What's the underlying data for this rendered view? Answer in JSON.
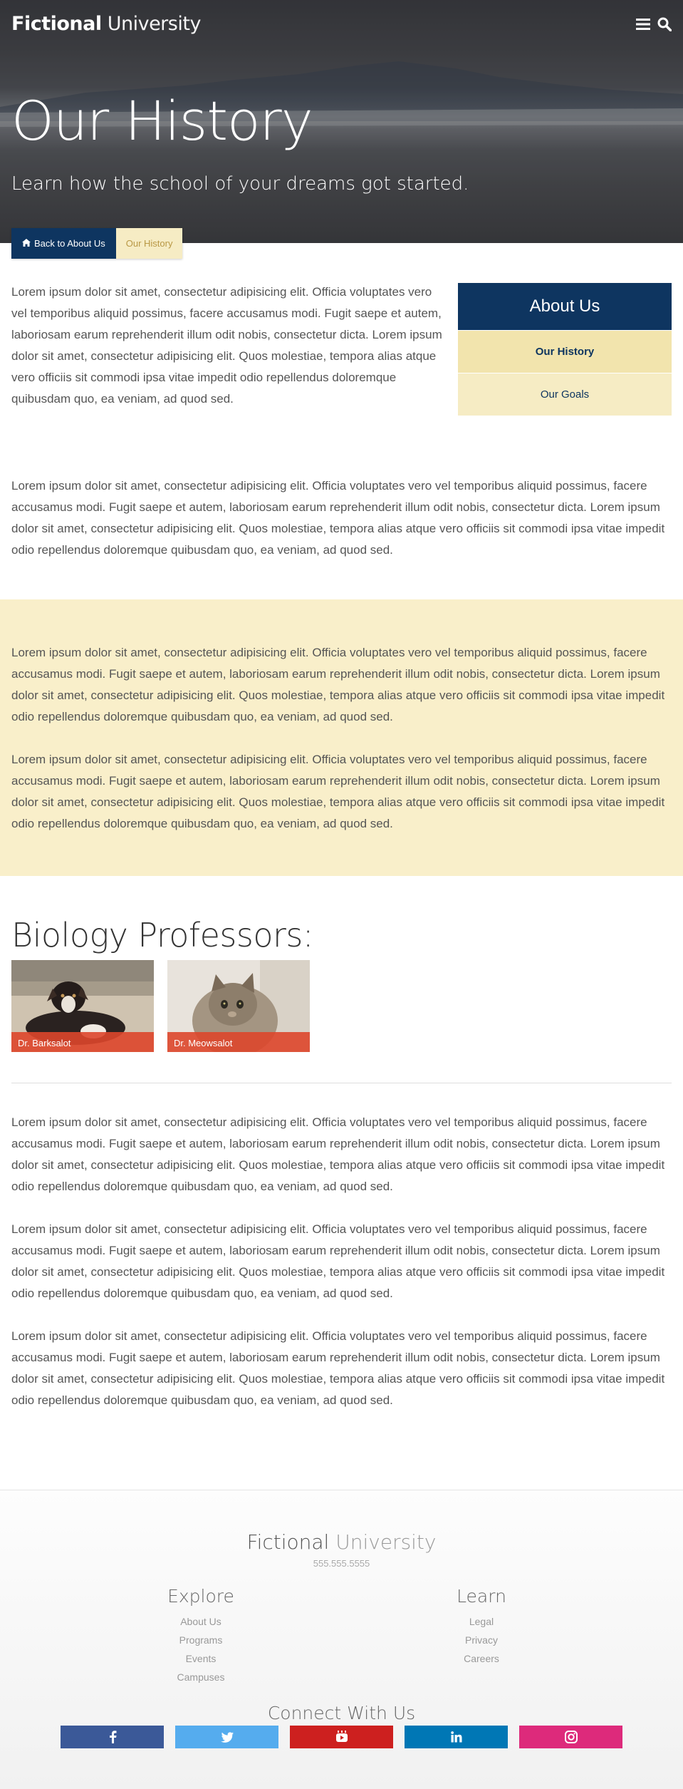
{
  "header": {
    "logo_bold": "Fictional",
    "logo_light": "University",
    "menu_icon": "menu-icon",
    "search_icon": "search-icon"
  },
  "hero": {
    "title": "Our History",
    "subtitle": "Learn how the school of your dreams got started."
  },
  "breadcrumb": {
    "back_label": "Back to About Us",
    "back_icon": "home-icon",
    "current_label": "Our History"
  },
  "sidebar": {
    "title": "About Us",
    "items": [
      {
        "label": "Our History",
        "active": true
      },
      {
        "label": "Our Goals",
        "active": false
      }
    ]
  },
  "paragraphs": {
    "intro": "Lorem ipsum dolor sit amet, consectetur adipisicing elit. Officia voluptates vero vel temporibus aliquid possimus, facere accusamus modi. Fugit saepe et autem, laboriosam earum reprehenderit illum odit nobis, consectetur dicta. Lorem ipsum dolor sit amet, consectetur adipisicing elit. Quos molestiae, tempora alias atque vero officiis sit commodi ipsa vitae impedit odio repellendus doloremque quibusdam quo, ea veniam, ad quod sed.",
    "second": "Lorem ipsum dolor sit amet, consectetur adipisicing elit. Officia voluptates vero vel temporibus aliquid possimus, facere accusamus modi. Fugit saepe et autem, laboriosam earum reprehenderit illum odit nobis, consectetur dicta. Lorem ipsum dolor sit amet, consectetur adipisicing elit. Quos molestiae, tempora alias atque vero officiis sit commodi ipsa vitae impedit odio repellendus doloremque quibusdam quo, ea veniam, ad quod sed.",
    "cream_1": "Lorem ipsum dolor sit amet, consectetur adipisicing elit. Officia voluptates vero vel temporibus aliquid possimus, facere accusamus modi. Fugit saepe et autem, laboriosam earum reprehenderit illum odit nobis, consectetur dicta. Lorem ipsum dolor sit amet, consectetur adipisicing elit. Quos molestiae, tempora alias atque vero officiis sit commodi ipsa vitae impedit odio repellendus doloremque quibusdam quo, ea veniam, ad quod sed.",
    "cream_2": "Lorem ipsum dolor sit amet, consectetur adipisicing elit. Officia voluptates vero vel temporibus aliquid possimus, facere accusamus modi. Fugit saepe et autem, laboriosam earum reprehenderit illum odit nobis, consectetur dicta. Lorem ipsum dolor sit amet, consectetur adipisicing elit. Quos molestiae, tempora alias atque vero officiis sit commodi ipsa vitae impedit odio repellendus doloremque quibusdam quo, ea veniam, ad quod sed.",
    "after_1": "Lorem ipsum dolor sit amet, consectetur adipisicing elit. Officia voluptates vero vel temporibus aliquid possimus, facere accusamus modi. Fugit saepe et autem, laboriosam earum reprehenderit illum odit nobis, consectetur dicta. Lorem ipsum dolor sit amet, consectetur adipisicing elit. Quos molestiae, tempora alias atque vero officiis sit commodi ipsa vitae impedit odio repellendus doloremque quibusdam quo, ea veniam, ad quod sed.",
    "after_2": "Lorem ipsum dolor sit amet, consectetur adipisicing elit. Officia voluptates vero vel temporibus aliquid possimus, facere accusamus modi. Fugit saepe et autem, laboriosam earum reprehenderit illum odit nobis, consectetur dicta. Lorem ipsum dolor sit amet, consectetur adipisicing elit. Quos molestiae, tempora alias atque vero officiis sit commodi ipsa vitae impedit odio repellendus doloremque quibusdam quo, ea veniam, ad quod sed.",
    "after_3": "Lorem ipsum dolor sit amet, consectetur adipisicing elit. Officia voluptates vero vel temporibus aliquid possimus, facere accusamus modi. Fugit saepe et autem, laboriosam earum reprehenderit illum odit nobis, consectetur dicta. Lorem ipsum dolor sit amet, consectetur adipisicing elit. Quos molestiae, tempora alias atque vero officiis sit commodi ipsa vitae impedit odio repellendus doloremque quibusdam quo, ea veniam, ad quod sed."
  },
  "professors": {
    "heading": "Biology Professors:",
    "items": [
      {
        "name": "Dr. Barksalot",
        "image": "dog-photo"
      },
      {
        "name": "Dr. Meowsalot",
        "image": "cat-photo"
      }
    ]
  },
  "footer": {
    "logo_bold": "Fictional",
    "logo_light": "University",
    "phone": "555.555.5555",
    "explore": {
      "title": "Explore",
      "links": [
        "About Us",
        "Programs",
        "Events",
        "Campuses"
      ]
    },
    "learn": {
      "title": "Learn",
      "links": [
        "Legal",
        "Privacy",
        "Careers"
      ]
    },
    "connect_title": "Connect With Us",
    "socials": [
      {
        "name": "facebook",
        "icon": "facebook-icon",
        "color": "#3b5998"
      },
      {
        "name": "twitter",
        "icon": "twitter-icon",
        "color": "#55acee"
      },
      {
        "name": "youtube",
        "icon": "youtube-icon",
        "color": "#cd201f"
      },
      {
        "name": "linkedin",
        "icon": "linkedin-icon",
        "color": "#0077b5"
      },
      {
        "name": "instagram",
        "icon": "instagram-icon",
        "color": "#dd2a7b"
      }
    ]
  },
  "colors": {
    "primary_blue": "#0e3560",
    "beige": "#f6ecc4",
    "cream_band": "#f9efca",
    "professor_label": "#dd462b"
  }
}
